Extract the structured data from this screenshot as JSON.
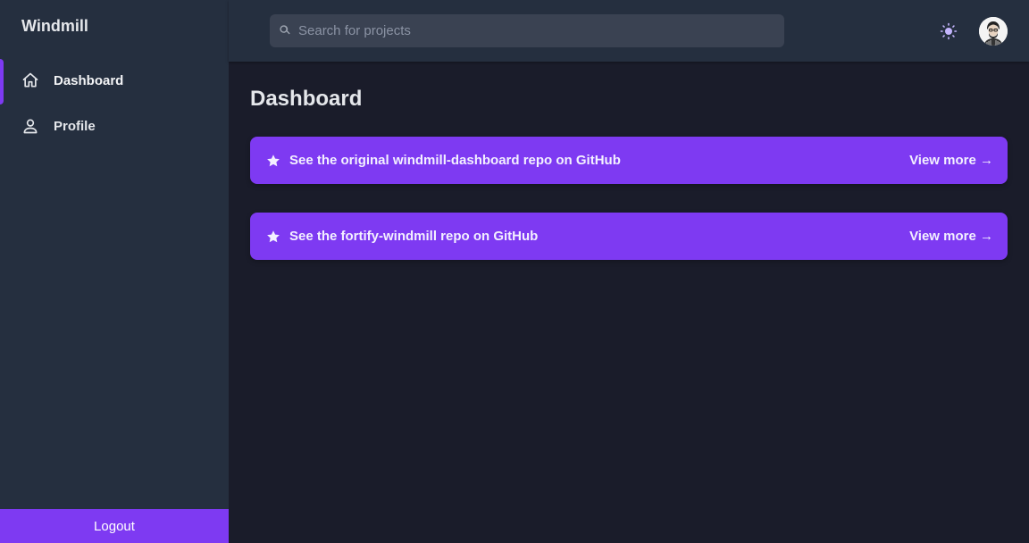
{
  "app": {
    "brand": "Windmill"
  },
  "sidebar": {
    "items": [
      {
        "label": "Dashboard",
        "icon": "home-icon",
        "active": true
      },
      {
        "label": "Profile",
        "icon": "user-icon",
        "active": false
      }
    ],
    "logout_label": "Logout"
  },
  "header": {
    "search": {
      "placeholder": "Search for projects",
      "value": ""
    },
    "theme_icon": "sun-icon",
    "avatar_icon": "avatar"
  },
  "main": {
    "title": "Dashboard",
    "cards": [
      {
        "text": "See the original windmill-dashboard repo on GitHub",
        "link": "View more →",
        "icon": "star-icon"
      },
      {
        "text": "See the fortify-windmill repo on GitHub",
        "link": "View more →",
        "icon": "star-icon"
      }
    ]
  },
  "colors": {
    "accent": "#7e3af2",
    "sidebar_bg": "#252f3f",
    "main_bg": "#1a1c2a",
    "search_bg": "#3a4252",
    "theme_icon": "#c4b5fd"
  }
}
